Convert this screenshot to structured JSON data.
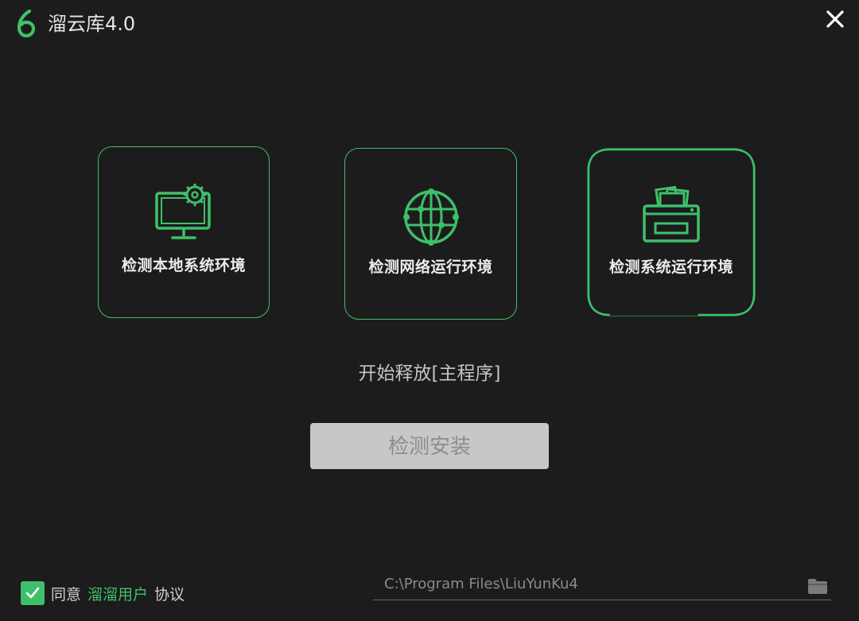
{
  "app": {
    "title": "溜云库4.0",
    "accent_color": "#3ec06b",
    "background_color": "#1c1c1c"
  },
  "icons": {
    "logo": "app-logo-icon",
    "close": "close-icon",
    "card_1": "monitor-gear-icon",
    "card_2": "globe-network-icon",
    "card_3": "printer-documents-icon",
    "checkbox": "checkmark-icon",
    "folder": "folder-icon"
  },
  "checks": [
    {
      "label": "检测本地系统环境"
    },
    {
      "label": "检测网络运行环境"
    },
    {
      "label": "检测系统运行环境"
    }
  ],
  "status": "开始释放[主程序]",
  "install_button": "检测安装",
  "agreement": {
    "checked": true,
    "prefix": "同意",
    "link": "溜溜用户",
    "suffix": "协议"
  },
  "install_path": {
    "value": "C:\\Program Files\\LiuYunKu4"
  }
}
